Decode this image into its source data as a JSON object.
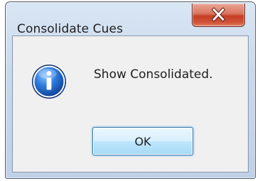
{
  "window": {
    "title": "Consolidate Cues",
    "close_icon": "close-x-icon"
  },
  "message": {
    "icon": "information-icon",
    "text": "Show Consolidated."
  },
  "buttons": {
    "ok_label": "OK"
  },
  "colors": {
    "frame": "#c9d9ec",
    "close_button": "#c53d23",
    "info_icon": "#1a5fc0",
    "ok_button_border": "#3c7fb1"
  }
}
